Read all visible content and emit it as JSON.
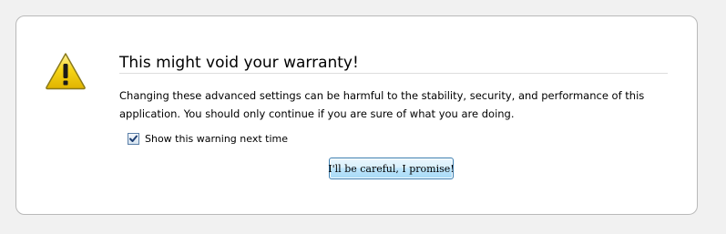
{
  "dialog": {
    "title": "This might void your warranty!",
    "description_lines": [
      "Changing these advanced settings can be harmful to the stability, security, and performance of this",
      "application. You should only continue if you are sure of what you are doing."
    ],
    "show_warning_checkbox": {
      "label": "Show this warning next time",
      "checked": true
    },
    "confirm_button_label": "I'll be careful, I promise!"
  },
  "icons": {
    "warning": "warning-icon"
  },
  "colors": {
    "warning_fill": "#f5d20f",
    "warning_border": "#8a7a1c",
    "button_border": "#3c7fb1"
  }
}
